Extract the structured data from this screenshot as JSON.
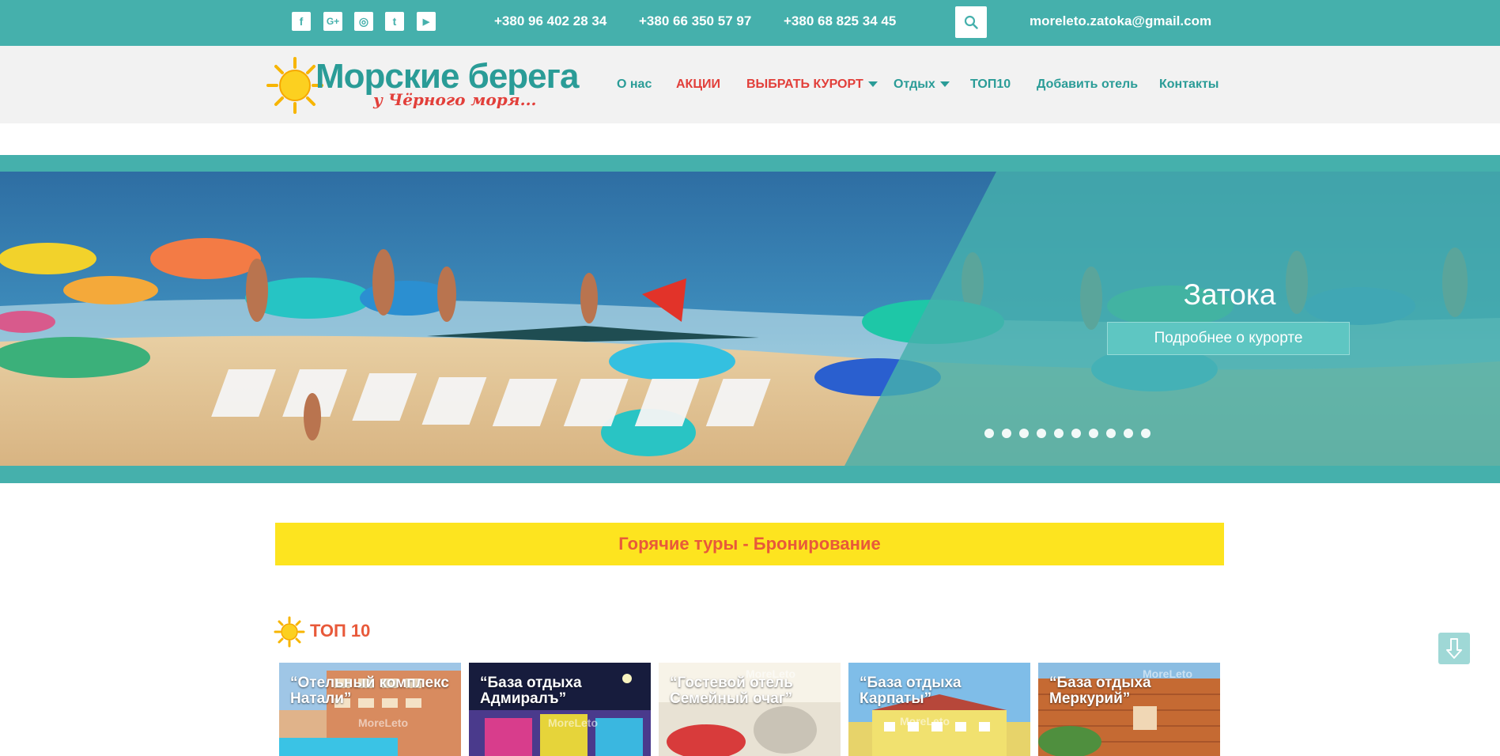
{
  "topbar": {
    "social": [
      {
        "name": "facebook-icon",
        "glyph": "f"
      },
      {
        "name": "google-plus-icon",
        "glyph": "G+"
      },
      {
        "name": "instagram-icon",
        "glyph": "◎"
      },
      {
        "name": "twitter-icon",
        "glyph": "t"
      },
      {
        "name": "youtube-icon",
        "glyph": "▶"
      }
    ],
    "phones": [
      "+380 96 402 28 34",
      "+380 66 350 57 97",
      "+380 68 825 34 45"
    ],
    "email": "moreleto.zatoka@gmail.com"
  },
  "header": {
    "logo": {
      "title": "Морские берега",
      "subtitle": "у Чёрного моря..."
    },
    "nav": [
      {
        "label": "О нас",
        "color": "#2a9c97"
      },
      {
        "label": "АКЦИИ",
        "color": "#e23f3a"
      },
      {
        "label": "ВЫБРАТЬ КУРОРТ",
        "color": "#e23f3a",
        "dropdown": true
      },
      {
        "label": "Отдых",
        "color": "#2a9c97",
        "dropdown": true
      },
      {
        "label": "ТОП10",
        "color": "#2a9c97"
      },
      {
        "label": "Добавить отель",
        "color": "#2a9c97"
      },
      {
        "label": "Контакты",
        "color": "#2a9c97"
      }
    ]
  },
  "hero": {
    "title": "Затока",
    "button_label": "Подробнее о курорте",
    "slide_count": 10,
    "active_slide": 1
  },
  "hot_tours": {
    "label": "Горячие туры - Бронирование"
  },
  "top10": {
    "title": "ТОП 10",
    "cards": [
      {
        "title": "“Отельный комплекс Натали”",
        "watermark": "MoreLeto"
      },
      {
        "title": "“База отдыха Адмиралъ”",
        "watermark": "MoreLeto"
      },
      {
        "title": "“Гостевой отель Семейный очаг”",
        "watermark": "MoreLeto"
      },
      {
        "title": "“База отдыха Карпаты”",
        "watermark": "MoreLeto"
      },
      {
        "title": "“База отдыха Меркурий”",
        "watermark": "MoreLeto"
      }
    ]
  },
  "colors": {
    "teal": "#45b0ac",
    "teal_text": "#2a9c97",
    "red": "#e23f3a",
    "orange": "#e8593a",
    "yellow": "#fde41f",
    "header_bg": "#f2f2f2"
  }
}
